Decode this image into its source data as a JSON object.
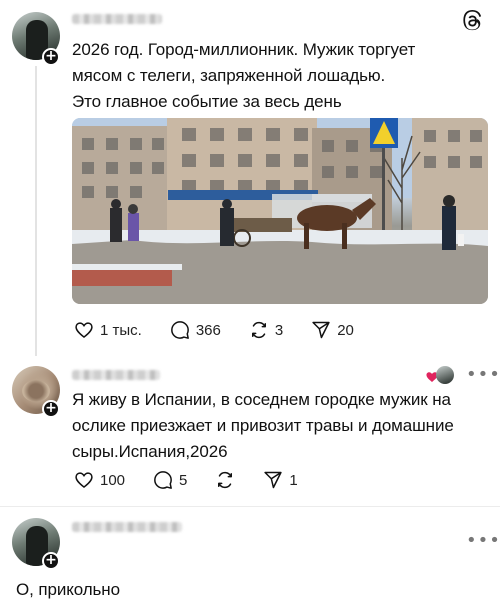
{
  "post": {
    "text_line1": "2026 год. Город-миллионник. Мужик торгует",
    "text_line2": "мясом с телеги, запряженной лошадью.",
    "text_line3": "Это главное событие за весь день",
    "likes": "1 тыс.",
    "comments": "366",
    "reposts": "3",
    "shares": "20"
  },
  "reply1": {
    "text_line1": "Я живу в Испании, в соседнем городке мужик на",
    "text_line2": "ослике приезжает и привозит травы и домашние",
    "text_line3": "сыры.Испания,2026",
    "likes": "100",
    "comments": "5",
    "shares": "1"
  },
  "reply2": {
    "text": "О, прикольно"
  },
  "icons": {
    "logo": "threads-logo-icon",
    "like": "heart-icon",
    "comment": "speech-bubble-icon",
    "repost": "repost-arrows-icon",
    "share": "paper-plane-icon",
    "more": "more-dots-icon",
    "follow": "plus-icon"
  },
  "colors": {
    "accent_heart": "#e0245e",
    "text": "#111111",
    "line": "#e3e3e3"
  }
}
